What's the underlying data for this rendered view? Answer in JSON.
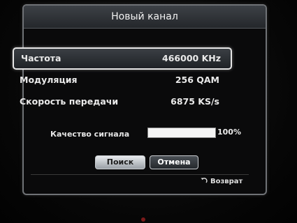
{
  "dialog": {
    "title": "Новый канал"
  },
  "params": [
    {
      "label": "Частота",
      "value": "466000 KHz",
      "focused": true
    },
    {
      "label": "Модуляция",
      "value": "256 QAM",
      "focused": false
    },
    {
      "label": "Скорость передачи",
      "value": "6875 KS/s",
      "focused": false
    }
  ],
  "signal": {
    "label": "Качество сигнала",
    "value_text": "100%",
    "level_percent": 100
  },
  "buttons": {
    "search": "Поиск",
    "cancel": "Отмена"
  },
  "footer": {
    "return_label": "Возврат",
    "return_icon": "return-arrow-icon"
  },
  "colors": {
    "focus_border": "#e6e6e6",
    "title_bar": "#2f3338",
    "dialog_border": "#6f7276"
  }
}
